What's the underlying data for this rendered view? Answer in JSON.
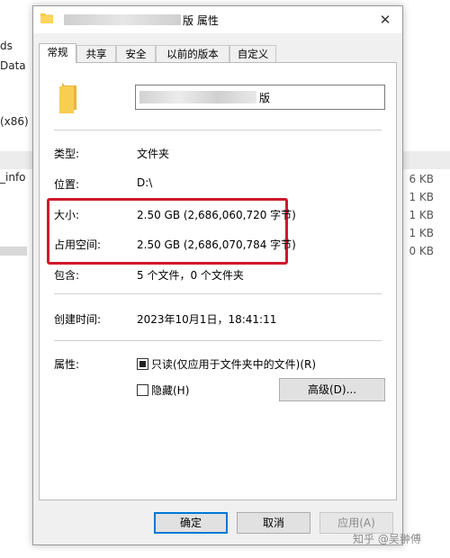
{
  "background": {
    "left_items": [
      "ds",
      "Data",
      "(x86)",
      "_info"
    ],
    "right_sizes": [
      "6 KB",
      "1 KB",
      "1 KB",
      "1 KB",
      "0 KB"
    ]
  },
  "dialog": {
    "title_suffix": "版 属性",
    "close_symbol": "✕",
    "tabs": [
      "常规",
      "共享",
      "安全",
      "以前的版本",
      "自定义"
    ],
    "name_suffix": "版",
    "rows": {
      "type": {
        "label": "类型:",
        "value": "文件夹"
      },
      "location": {
        "label": "位置:",
        "value": "D:\\"
      },
      "size": {
        "label": "大小:",
        "value": "2.50 GB (2,686,060,720 字节)"
      },
      "size_on_disk": {
        "label": "占用空间:",
        "value": "2.50 GB (2,686,070,784 字节)"
      },
      "contains": {
        "label": "包含:",
        "value": "5 个文件，0 个文件夹"
      },
      "created": {
        "label": "创建时间:",
        "value": "2023年10月1日，18:41:11"
      }
    },
    "attributes": {
      "label": "属性:",
      "readonly_label": "只读(仅应用于文件夹中的文件)(R)",
      "hidden_label": "隐藏(H)",
      "advanced_button": "高级(D)..."
    },
    "buttons": {
      "ok": "确定",
      "cancel": "取消",
      "apply": "应用(A)"
    }
  },
  "watermark": "知乎 @吴翀傅",
  "colors": {
    "highlight_border": "#d0182c",
    "folder": "#f5c842",
    "primary_button_border": "#0078d7"
  }
}
